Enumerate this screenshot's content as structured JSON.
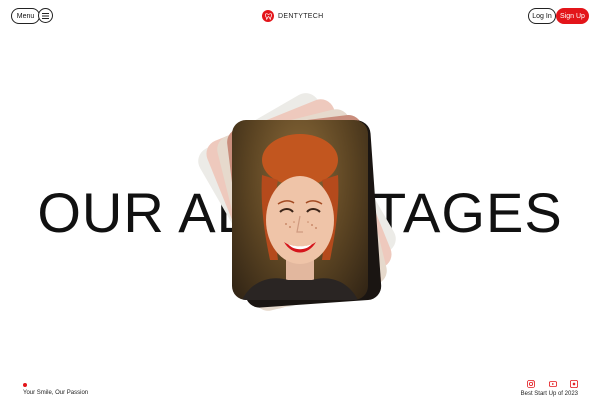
{
  "header": {
    "menu_label": "Menu",
    "brand_name": "DENTYTECH",
    "login_label": "Log In",
    "signup_label": "Sign Up"
  },
  "hero": {
    "headline": "OUR ADVANTAGES"
  },
  "footer": {
    "tagline": "Your Smile, Our Passion",
    "award": "Best Start Up of 2023",
    "social_icons": [
      "instagram-icon",
      "youtube-icon",
      "social-icon"
    ]
  },
  "colors": {
    "accent": "#e3151a",
    "text": "#111111",
    "background": "#ffffff"
  }
}
